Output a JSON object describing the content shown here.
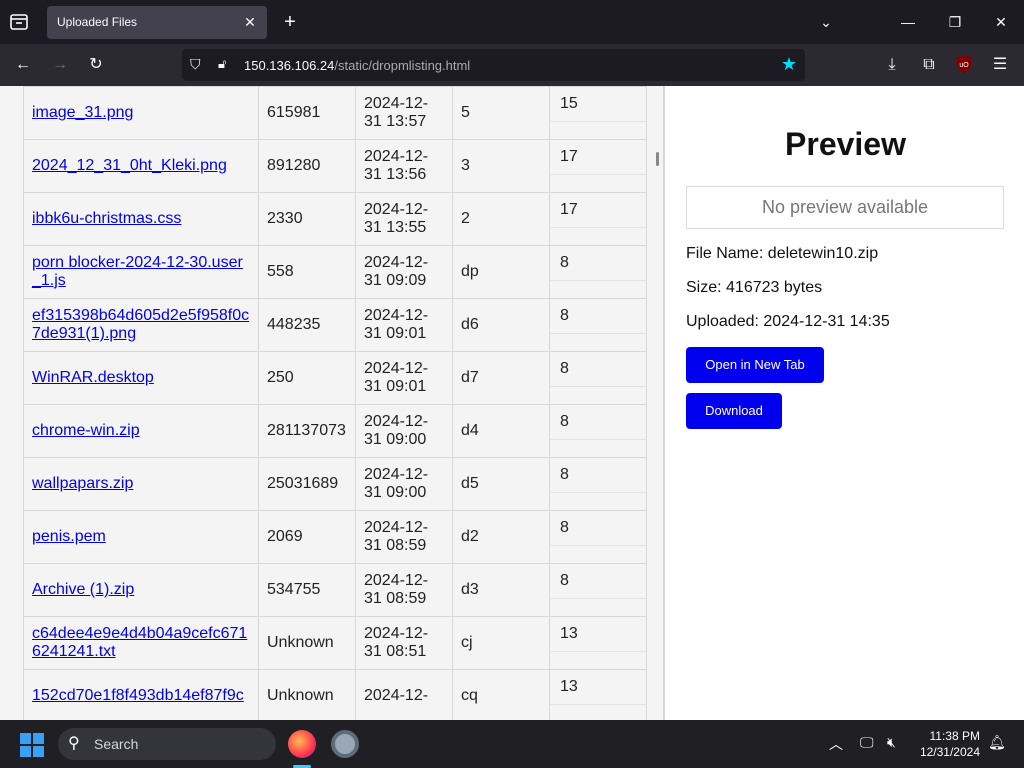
{
  "browser": {
    "tab_title": "Uploaded Files",
    "url_host": "150.136.106.24",
    "url_path": "/static/dropmlisting.html"
  },
  "files": [
    {
      "name": "image_31.png",
      "size": "615981",
      "date": "2024-12-31 13:57",
      "type": "5",
      "count": "15"
    },
    {
      "name": "2024_12_31_0ht_Kleki.png",
      "size": "891280",
      "date": "2024-12-31 13:56",
      "type": "3",
      "count": "17"
    },
    {
      "name": "ibbk6u-christmas.css",
      "size": "2330",
      "date": "2024-12-31 13:55",
      "type": "2",
      "count": "17"
    },
    {
      "name": "porn blocker-2024-12-30.user_1.js",
      "size": "558",
      "date": "2024-12-31 09:09",
      "type": "dp",
      "count": "8"
    },
    {
      "name": "ef315398b64d605d2e5f958f0c7de931(1).png",
      "size": "448235",
      "date": "2024-12-31 09:01",
      "type": "d6",
      "count": "8"
    },
    {
      "name": "WinRAR.desktop",
      "size": "250",
      "date": "2024-12-31 09:01",
      "type": "d7",
      "count": "8"
    },
    {
      "name": "chrome-win.zip",
      "size": "281137073",
      "date": "2024-12-31 09:00",
      "type": "d4",
      "count": "8"
    },
    {
      "name": "wallpapars.zip",
      "size": "25031689",
      "date": "2024-12-31 09:00",
      "type": "d5",
      "count": "8"
    },
    {
      "name": "penis.pem",
      "size": "2069",
      "date": "2024-12-31 08:59",
      "type": "d2",
      "count": "8"
    },
    {
      "name": "Archive (1).zip",
      "size": "534755",
      "date": "2024-12-31 08:59",
      "type": "d3",
      "count": "8"
    },
    {
      "name": "c64dee4e9e4d4b04a9cefc6716241241.txt",
      "size": "Unknown",
      "date": "2024-12-31 08:51",
      "type": "cj",
      "count": "13"
    },
    {
      "name": "152cd70e1f8f493db14ef87f9c",
      "size": "Unknown",
      "date": "2024-12-",
      "type": "cq",
      "count": "13"
    }
  ],
  "preview": {
    "title": "Preview",
    "no_preview": "No preview available",
    "file_name": "File Name: deletewin10.zip",
    "size": "Size: 416723 bytes",
    "uploaded": "Uploaded: 2024-12-31 14:35",
    "open_label": "Open in New Tab",
    "download_label": "Download"
  },
  "taskbar": {
    "search_label": "Search",
    "time": "11:38 PM",
    "date": "12/31/2024"
  }
}
